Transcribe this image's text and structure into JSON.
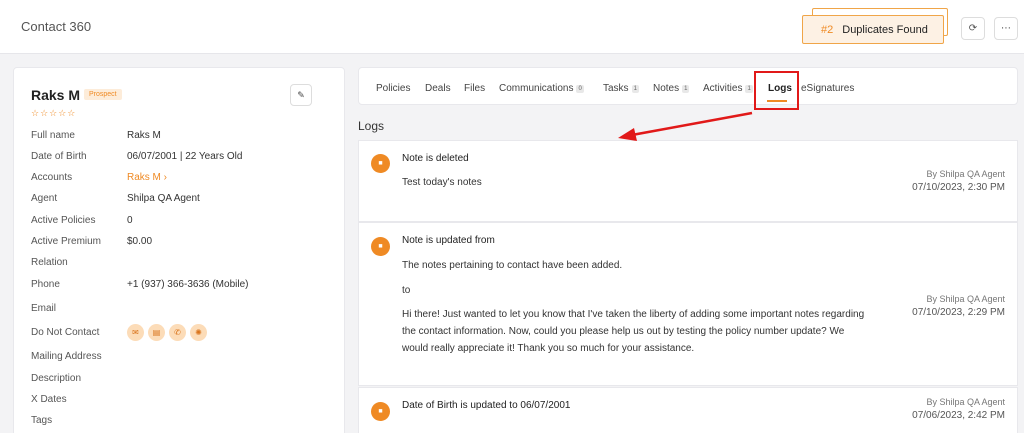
{
  "header": {
    "title": "Contact 360",
    "duplicates": {
      "number": "#2",
      "label": "Duplicates Found"
    }
  },
  "contact": {
    "name": "Raks M",
    "badge": "Prospect",
    "rating": "☆☆☆☆☆",
    "fields": [
      {
        "label": "Full name",
        "value": "Raks M"
      },
      {
        "label": "Date of Birth",
        "value": "06/07/2001 | 22 Years Old"
      },
      {
        "label": "Accounts",
        "value": "Raks M ›"
      },
      {
        "label": "Agent",
        "value": "Shilpa QA Agent"
      },
      {
        "label": "Active Policies",
        "value": "0"
      },
      {
        "label": "Active Premium",
        "value": "$0.00"
      },
      {
        "label": "Relation",
        "value": ""
      },
      {
        "label": "Phone",
        "value": "+1 (937) 366-3636 (Mobile)"
      },
      {
        "label": "Email",
        "value": ""
      },
      {
        "label": "Do Not Contact",
        "value": ""
      },
      {
        "label": "Mailing Address",
        "value": ""
      },
      {
        "label": "Description",
        "value": ""
      },
      {
        "label": "X Dates",
        "value": ""
      },
      {
        "label": "Tags",
        "value": ""
      }
    ]
  },
  "tabs": [
    {
      "label": "Policies",
      "count": ""
    },
    {
      "label": "Deals",
      "count": ""
    },
    {
      "label": "Files",
      "count": ""
    },
    {
      "label": "Communications",
      "count": "0"
    },
    {
      "label": "Tasks",
      "count": "1"
    },
    {
      "label": "Notes",
      "count": "1"
    },
    {
      "label": "Activities",
      "count": "1"
    },
    {
      "label": "Logs",
      "count": ""
    },
    {
      "label": "eSignatures",
      "count": ""
    }
  ],
  "logs": {
    "heading": "Logs",
    "entries": [
      {
        "title": "Note is deleted",
        "lines": [
          "Test today's notes"
        ],
        "by": "By Shilpa QA Agent",
        "when": "07/10/2023, 2:30 PM"
      },
      {
        "title": "Note is updated from",
        "lines": [
          "The notes pertaining to contact have been added.",
          "to",
          "Hi there! Just wanted to let you know that I've taken the liberty of adding some important notes regarding",
          "the contact information. Now, could you please help us out by testing the policy number update? We",
          "would really appreciate it! Thank you so much for your assistance."
        ],
        "by": "By Shilpa QA Agent",
        "when": "07/10/2023, 2:29 PM"
      },
      {
        "title": "Date of Birth is updated to 06/07/2001",
        "lines": [],
        "by": "By Shilpa QA Agent",
        "when": "07/06/2023, 2:42 PM"
      }
    ]
  },
  "colors": {
    "accent": "#ef8a24",
    "annotation": "#e11919"
  }
}
